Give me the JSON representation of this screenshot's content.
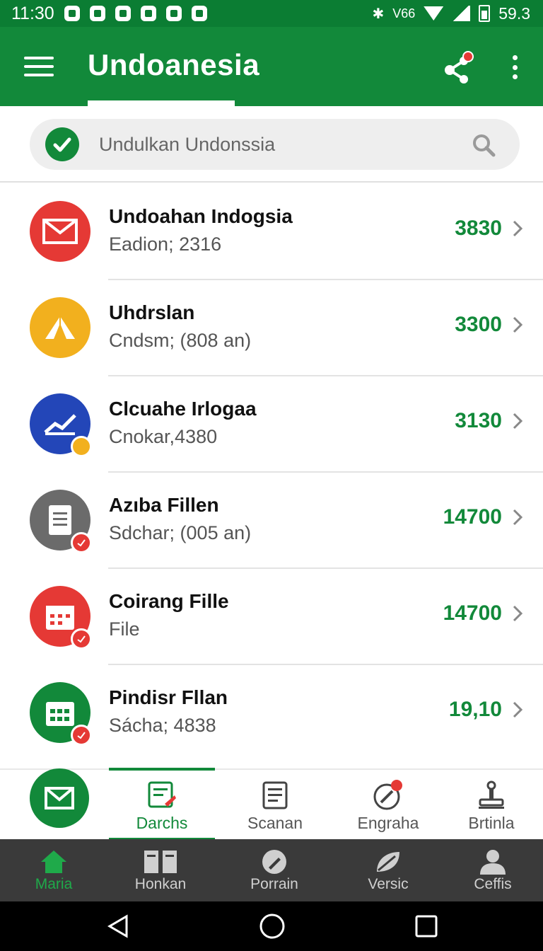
{
  "status_bar": {
    "time": "11:30",
    "network": "V66",
    "battery": "59.3"
  },
  "app_bar": {
    "title": "Undoanesia"
  },
  "search": {
    "placeholder": "Undulkan Undonssia"
  },
  "list": [
    {
      "title": "Undoahan Indogsia",
      "subtitle": "Eadion; 2316",
      "value": "3830",
      "icon": "mail-icon",
      "color": "#e53935"
    },
    {
      "title": "Uhdrslan",
      "subtitle": "Cndsm; (808 an)",
      "value": "3300",
      "icon": "tent-icon",
      "color": "#f2b01e"
    },
    {
      "title": "Clcuahe Irlogaa",
      "subtitle": "Cnokar,4380",
      "value": "3130",
      "icon": "chart-icon",
      "color": "#2346b8"
    },
    {
      "title": "Azıba Fillen",
      "subtitle": "Sdchar; (005 an)",
      "value": "14700",
      "icon": "document-icon",
      "color": "#6b6b6b"
    },
    {
      "title": "Coirang Fille",
      "subtitle": "File",
      "value": "14700",
      "icon": "calendar-icon",
      "color": "#e53935"
    },
    {
      "title": "Pindisr Fllan",
      "subtitle": "Sácha; 4838",
      "value": "19,10",
      "icon": "calendar-grid-icon",
      "color": "#12893a"
    }
  ],
  "tabs": [
    {
      "label": "Darchs",
      "icon": "edit-document-icon"
    },
    {
      "label": "Scanan",
      "icon": "scan-document-icon"
    },
    {
      "label": "Engraha",
      "icon": "compass-icon"
    },
    {
      "label": "Brtinla",
      "icon": "stamp-icon"
    }
  ],
  "bottom_nav": [
    {
      "label": "Maria",
      "icon": "home-icon"
    },
    {
      "label": "Honkan",
      "icon": "columns-icon"
    },
    {
      "label": "Porrain",
      "icon": "pen-circle-icon"
    },
    {
      "label": "Versic",
      "icon": "leaf-icon"
    },
    {
      "label": "Ceffis",
      "icon": "person-icon"
    }
  ],
  "colors": {
    "primary": "#12893a",
    "status_bar": "#0b7d33",
    "accent_red": "#e53935",
    "nav_dark": "#3a3a3a"
  }
}
